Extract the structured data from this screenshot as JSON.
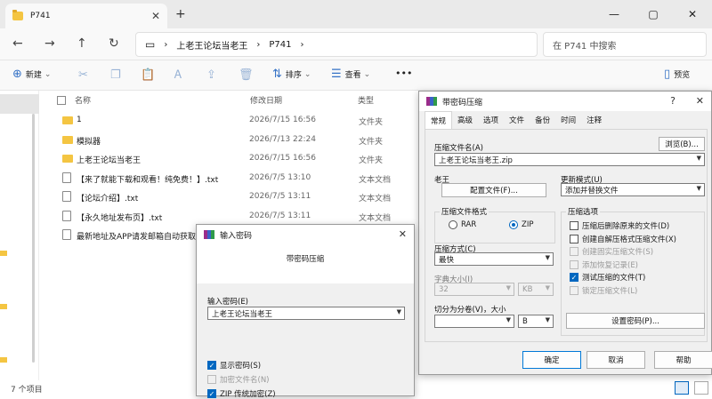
{
  "window": {
    "tab_title": "P741",
    "tab_close": "✕",
    "new_tab": "+",
    "min": "—",
    "max": "▢",
    "close": "✕"
  },
  "nav": {
    "back": "←",
    "forward": "→",
    "up": "↑",
    "refresh": "↻",
    "monitor": "▭",
    "sep": "›",
    "crumbs": [
      "上老王论坛当老王",
      "P741"
    ],
    "search_placeholder": "在 P741 中搜索"
  },
  "toolbar": {
    "new": "新建",
    "sort": "排序",
    "view": "查看",
    "more": "•••",
    "preview": "预览",
    "plus": "⊕",
    "sort_icon": "⇅",
    "view_icon": "☰",
    "preview_icon": "▯",
    "chev": "⌄",
    "cut": "✂",
    "copy": "❐",
    "paste": "📋",
    "rename": "Ꭺ",
    "share": "⇪",
    "delete": "🗑"
  },
  "headers": {
    "name": "名称",
    "date": "修改日期",
    "type": "类型"
  },
  "files": [
    {
      "name": "1",
      "date": "2026/7/15 16:56",
      "type": "文件夹",
      "kind": "folder"
    },
    {
      "name": "模拟器",
      "date": "2026/7/13 22:24",
      "type": "文件夹",
      "kind": "folder"
    },
    {
      "name": "上老王论坛当老王",
      "date": "2026/7/15 16:56",
      "type": "文件夹",
      "kind": "folder"
    },
    {
      "name": "【来了就能下载和观看！纯免费！】.txt",
      "date": "2026/7/5 13:10",
      "type": "文本文档",
      "kind": "txt"
    },
    {
      "name": "【论坛介绍】.txt",
      "date": "2026/7/5 13:11",
      "type": "文本文档",
      "kind": "txt"
    },
    {
      "name": "【永久地址发布页】.txt",
      "date": "2026/7/5 13:11",
      "type": "文本文档",
      "kind": "txt"
    },
    {
      "name": "最新地址及APP请发邮箱自动获取",
      "date": "",
      "type": "",
      "kind": "txt"
    }
  ],
  "status": {
    "count": "7 个项目"
  },
  "archive_dialog": {
    "title": "带密码压缩",
    "help": "?",
    "close": "✕",
    "tabs": [
      "常规",
      "高级",
      "选项",
      "文件",
      "备份",
      "时间",
      "注释"
    ],
    "archive_name_label": "压缩文件名(A)",
    "browse": "浏览(B)...",
    "archive_name": "上老王论坛当老王.zip",
    "profile_label": "老王",
    "config_button": "配置文件(F)...",
    "update_label": "更新模式(U)",
    "update_value": "添加并替换文件",
    "format_label": "压缩文件格式",
    "rar": "RAR",
    "zip": "ZIP",
    "options_label": "压缩选项",
    "options": [
      {
        "label": "压缩后删除原来的文件(D)",
        "checked": false,
        "disabled": false
      },
      {
        "label": "创建自解压格式压缩文件(X)",
        "checked": false,
        "disabled": false
      },
      {
        "label": "创建固实压缩文件(S)",
        "checked": false,
        "disabled": true
      },
      {
        "label": "添加恢复记录(E)",
        "checked": false,
        "disabled": true
      },
      {
        "label": "测试压缩的文件(T)",
        "checked": true,
        "disabled": false
      },
      {
        "label": "锁定压缩文件(L)",
        "checked": false,
        "disabled": true
      }
    ],
    "method_label": "压缩方式(C)",
    "method_value": "最快",
    "dict_label": "字典大小(I)",
    "dict_value": "32",
    "dict_unit": "KB",
    "split_label": "切分为分卷(V)，大小",
    "split_unit": "B",
    "set_password": "设置密码(P)...",
    "ok": "确定",
    "cancel": "取消",
    "help_btn": "帮助"
  },
  "password_dialog": {
    "title": "输入密码",
    "close": "✕",
    "subtitle": "带密码压缩",
    "label": "输入密码(E)",
    "value": "上老王论坛当老王",
    "show_password": "显示密码(S)",
    "encrypt_names": "加密文件名(N)",
    "zip_legacy": "ZIP 传统加密(Z)"
  }
}
